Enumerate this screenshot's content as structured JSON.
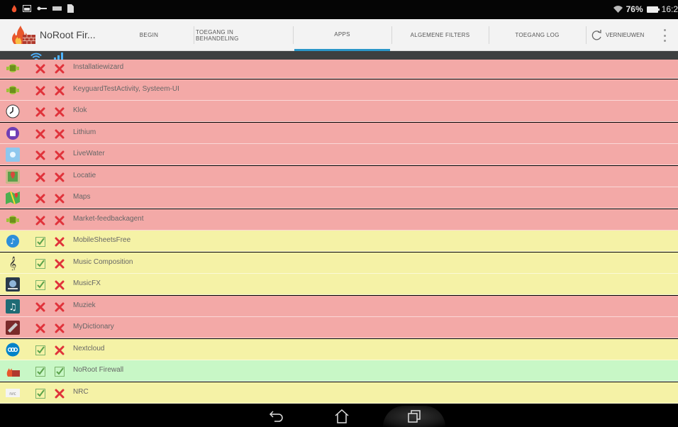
{
  "status_bar": {
    "battery_percent": "76%",
    "time": "16:2",
    "icons": [
      "flame-icon",
      "gallery-icon",
      "key-icon",
      "card-icon",
      "document-icon",
      "wifi-icon",
      "battery-icon"
    ]
  },
  "action_bar": {
    "app_title": "NoRoot Fir...",
    "tabs": [
      {
        "label": "BEGIN",
        "active": false
      },
      {
        "label": "TOEGANG IN BEHANDELING",
        "active": false
      },
      {
        "label": "APPS",
        "active": true
      },
      {
        "label": "ALGEMENE FILTERS",
        "active": false
      },
      {
        "label": "TOEGANG LOG",
        "active": false
      }
    ],
    "refresh_label": "VERNIEUWEN",
    "accent_color": "#2a96c8"
  },
  "columns": {
    "wifi_icon": "wifi-icon",
    "data_icon": "signal-icon"
  },
  "colors": {
    "blocked": "#f3a9a7",
    "partial": "#f5f2a6",
    "allowed": "#c8f7c6"
  },
  "apps": [
    {
      "name": "Installatiewizard",
      "icon": "android-icon",
      "wifi": false,
      "data": false,
      "status": "red"
    },
    {
      "name": "KeyguardTestActivity, Systeem-UI",
      "icon": "android-icon",
      "wifi": false,
      "data": false,
      "status": "red"
    },
    {
      "name": "Klok",
      "icon": "clock-icon",
      "wifi": false,
      "data": false,
      "status": "red"
    },
    {
      "name": "Lithium",
      "icon": "lithium-icon",
      "wifi": false,
      "data": false,
      "status": "red"
    },
    {
      "name": "LiveWater",
      "icon": "water-icon",
      "wifi": false,
      "data": false,
      "status": "red"
    },
    {
      "name": "Locatie",
      "icon": "location-icon",
      "wifi": false,
      "data": false,
      "status": "red"
    },
    {
      "name": "Maps",
      "icon": "maps-icon",
      "wifi": false,
      "data": false,
      "status": "red"
    },
    {
      "name": "Market-feedbackagent",
      "icon": "android-icon",
      "wifi": false,
      "data": false,
      "status": "red"
    },
    {
      "name": "MobileSheetsFree",
      "icon": "sheets-icon",
      "wifi": true,
      "data": false,
      "status": "yellow"
    },
    {
      "name": "Music Composition",
      "icon": "treble-clef-icon",
      "wifi": true,
      "data": false,
      "status": "yellow"
    },
    {
      "name": "MusicFX",
      "icon": "musicfx-icon",
      "wifi": true,
      "data": false,
      "status": "yellow"
    },
    {
      "name": "Muziek",
      "icon": "music-note-icon",
      "wifi": false,
      "data": false,
      "status": "red"
    },
    {
      "name": "MyDictionary",
      "icon": "dictionary-icon",
      "wifi": false,
      "data": false,
      "status": "red"
    },
    {
      "name": "Nextcloud",
      "icon": "nextcloud-icon",
      "wifi": true,
      "data": false,
      "status": "yellow"
    },
    {
      "name": "NoRoot Firewall",
      "icon": "firewall-icon",
      "wifi": true,
      "data": true,
      "status": "green"
    },
    {
      "name": "NRC",
      "icon": "nrc-icon",
      "wifi": true,
      "data": false,
      "status": "yellow"
    }
  ]
}
